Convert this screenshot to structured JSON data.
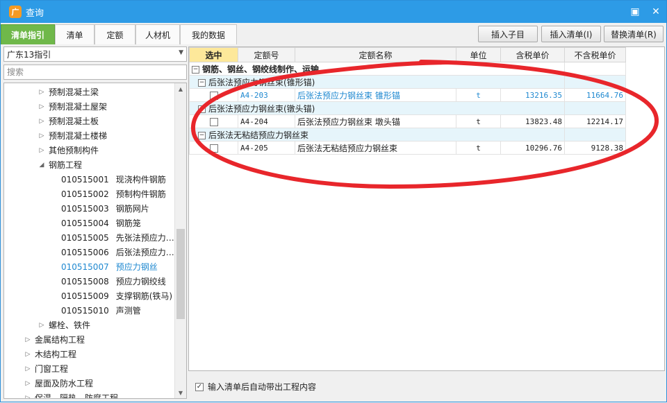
{
  "window": {
    "title": "查询",
    "app_icon_glyph": "广",
    "minimize_glyph": "▣",
    "close_glyph": "✕"
  },
  "tabs": [
    {
      "label": "清单指引",
      "active": true
    },
    {
      "label": "清单"
    },
    {
      "label": "定额"
    },
    {
      "label": "人材机"
    },
    {
      "label": "我的数据"
    }
  ],
  "actions": {
    "insert_child": "插入子目",
    "insert_list": "插入清单(I)",
    "replace_list": "替换清单(R)"
  },
  "left": {
    "dropdown_value": "广东13指引",
    "search_placeholder": "搜索",
    "tree": [
      {
        "arrow": "▷",
        "label": "预制混凝土梁"
      },
      {
        "arrow": "▷",
        "label": "预制混凝土屋架"
      },
      {
        "arrow": "▷",
        "label": "预制混凝土板"
      },
      {
        "arrow": "▷",
        "label": "预制混凝土楼梯"
      },
      {
        "arrow": "▷",
        "label": "其他预制构件"
      },
      {
        "arrow": "◢",
        "label": "钢筋工程"
      },
      {
        "code": "010515001",
        "label": "现浇构件钢筋"
      },
      {
        "code": "010515002",
        "label": "预制构件钢筋"
      },
      {
        "code": "010515003",
        "label": "钢筋网片"
      },
      {
        "code": "010515004",
        "label": "钢筋笼"
      },
      {
        "code": "010515005",
        "label": "先张法预应力…"
      },
      {
        "code": "010515006",
        "label": "后张法预应力…"
      },
      {
        "code": "010515007",
        "label": "预应力钢丝",
        "selected": true
      },
      {
        "code": "010515008",
        "label": "预应力钢绞线"
      },
      {
        "code": "010515009",
        "label": "支撑钢筋(铁马)"
      },
      {
        "code": "010515010",
        "label": "声测管"
      },
      {
        "arrow": "▷",
        "label": "螺栓、铁件"
      },
      {
        "arrow": "▷",
        "label": "金属结构工程"
      },
      {
        "arrow": "▷",
        "label": "木结构工程"
      },
      {
        "arrow": "▷",
        "label": "门窗工程"
      },
      {
        "arrow": "▷",
        "label": "屋面及防水工程"
      },
      {
        "arrow": "▷",
        "label": "保温、隔热、防腐工程"
      }
    ],
    "scroll_up_glyph": "▲",
    "scroll_down_glyph": "▼"
  },
  "grid": {
    "headers": [
      "选中",
      "定额号",
      "定额名称",
      "单位",
      "含税单价",
      "不含税单价"
    ],
    "group_title": "钢筋、钢丝、钢绞线制作、运输",
    "subgroups": [
      {
        "title": "后张法预应力钢丝束(锥形锚)",
        "row": {
          "code": "A4-203",
          "name": "后张法预应力钢丝束 锥形锚",
          "unit": "t",
          "price_tax": "13216.35",
          "price_notax": "11664.76",
          "highlight": true
        }
      },
      {
        "title": "后张法预应力钢丝束(镦头锚)",
        "row": {
          "code": "A4-204",
          "name": "后张法预应力钢丝束 墩头锚",
          "unit": "t",
          "price_tax": "13823.48",
          "price_notax": "12214.17"
        }
      },
      {
        "title": "后张法无粘结预应力钢丝束",
        "row": {
          "code": "A4-205",
          "name": "后张法无粘结预应力钢丝束",
          "unit": "t",
          "price_tax": "10296.76",
          "price_notax": "9128.38"
        }
      }
    ],
    "collapse_glyph": "−"
  },
  "bottom": {
    "checkbox_label": "输入清单后自动带出工程内容",
    "checked": true,
    "check_glyph": "✓"
  },
  "colors": {
    "title_bar": "#2d9be6",
    "active_tab": "#6fb84a",
    "select_header": "#fde89a",
    "link_blue": "#1e88d0",
    "annotation_red": "#e8262b"
  }
}
